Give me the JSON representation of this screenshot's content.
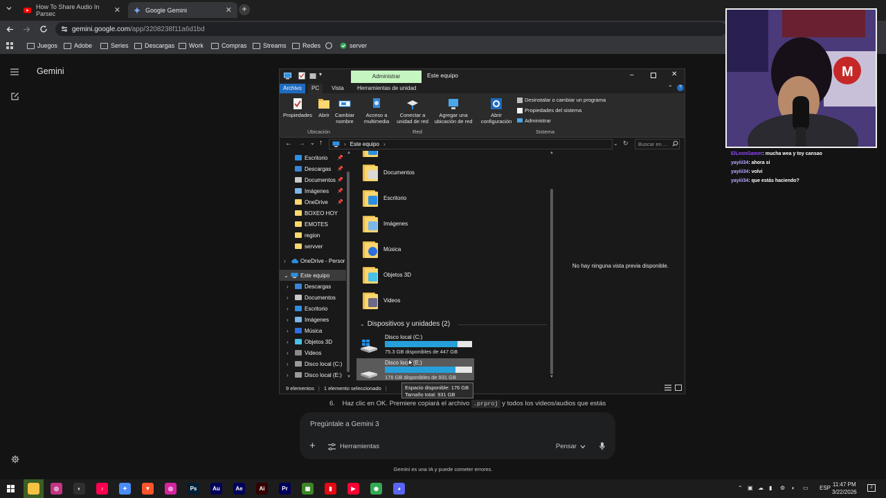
{
  "browser": {
    "tabs": [
      {
        "label": "How To Share Audio In Parsec",
        "icon": "youtube-icon",
        "active": false
      },
      {
        "label": "Google Gemini",
        "icon": "gemini-icon",
        "active": true
      }
    ],
    "url_host": "gemini.google.com",
    "url_path": "/app/3208238f11a6d1bd",
    "bookmarks": [
      "Juegos",
      "Adobe",
      "Series",
      "Descargas",
      "Work",
      "Compras",
      "Streams",
      "Redes",
      "server"
    ]
  },
  "gemini": {
    "title": "Gemini",
    "step_prefix": "6.",
    "step_text_1": "Haz clic en OK. Premiere copiará el archivo",
    "step_code": ".prproj",
    "step_text_2": "y todos los videos/audios que estás",
    "prompt_placeholder": "Pregúntale a Gemini 3",
    "tools_label": "Herramientas",
    "think_label": "Pensar",
    "disclaimer": "Gemini es una IA y puede cometer errores."
  },
  "explorer": {
    "context_tab": "Administrar",
    "window_title": "Este equipo",
    "tabs": [
      "Archivo",
      "PC",
      "Vista",
      "Herramientas de unidad"
    ],
    "ribbon": {
      "buttons": [
        {
          "label_1": "Propiedades",
          "label_2": "",
          "icon": "properties-icon"
        },
        {
          "label_1": "Abrir",
          "label_2": "",
          "icon": "open-icon"
        },
        {
          "label_1": "Cambiar",
          "label_2": "nombre",
          "icon": "rename-icon"
        },
        {
          "label_1": "Acceso a",
          "label_2": "multimedia",
          "icon": "media-access-icon"
        },
        {
          "label_1": "Conectar a",
          "label_2": "unidad de red",
          "icon": "network-drive-icon"
        },
        {
          "label_1": "Agregar una",
          "label_2": "ubicación de red",
          "icon": "network-location-icon"
        },
        {
          "label_1": "Abrir",
          "label_2": "configuración",
          "icon": "settings-icon"
        }
      ],
      "small": [
        "Desinstalar o cambiar un programa",
        "Propiedades del sistema",
        "Administrar"
      ],
      "groups": [
        "Ubicación",
        "Red",
        "Sistema"
      ]
    },
    "breadcrumb": "Este equipo",
    "search_placeholder": "Buscar en ...",
    "quick_access": [
      {
        "label": "Escritorio",
        "pinned": true,
        "color": "#2d8fe0"
      },
      {
        "label": "Descargas",
        "pinned": true,
        "color": "#3a86d6"
      },
      {
        "label": "Documentos",
        "pinned": true,
        "color": "#c9c9c9"
      },
      {
        "label": "Imágenes",
        "pinned": true,
        "color": "#7db6e8"
      },
      {
        "label": "OneDrive",
        "pinned": true,
        "color": "#f9d66e"
      },
      {
        "label": "BOXEO HOY",
        "pinned": false,
        "color": "#f9d66e"
      },
      {
        "label": "EMOTES",
        "pinned": false,
        "color": "#f9d66e"
      },
      {
        "label": "region",
        "pinned": false,
        "color": "#f9d66e"
      },
      {
        "label": "servver",
        "pinned": false,
        "color": "#f9d66e"
      }
    ],
    "onedrive_label": "OneDrive - Persor",
    "this_pc_label": "Este equipo",
    "this_pc_items": [
      {
        "label": "Descargas",
        "color": "#3a86d6"
      },
      {
        "label": "Documentos",
        "color": "#c9c9c9"
      },
      {
        "label": "Escritorio",
        "color": "#2d8fe0"
      },
      {
        "label": "Imágenes",
        "color": "#7db6e8"
      },
      {
        "label": "Música",
        "color": "#2d6fe0"
      },
      {
        "label": "Objetos 3D",
        "color": "#49c0e8"
      },
      {
        "label": "Videos",
        "color": "#8a8a8a"
      },
      {
        "label": "Disco local (C:)",
        "color": "#9a9a9a"
      },
      {
        "label": "Disco local (E:)",
        "color": "#9a9a9a"
      }
    ],
    "folders": [
      {
        "label": "Documentos",
        "emblem": "#d9d9d9"
      },
      {
        "label": "Escritorio",
        "emblem": "#2d8fe0"
      },
      {
        "label": "Imágenes",
        "emblem": "#7db6e8"
      },
      {
        "label": "Música",
        "emblem": "#2d6fe0"
      },
      {
        "label": "Objetos 3D",
        "emblem": "#49c0e8"
      },
      {
        "label": "Videos",
        "emblem": "#6a6a8a"
      }
    ],
    "devices_header": "Dispositivos y unidades (2)",
    "drives": [
      {
        "name": "Disco local (C:)",
        "free": "75.3 GB disponibles de 447 GB",
        "used_fraction": 0.83,
        "selected": false
      },
      {
        "name": "Disco local (E:)",
        "free": "176 GB disponibles de 931 GB",
        "used_fraction": 0.81,
        "selected": true
      }
    ],
    "preview_text": "No hay ninguna vista previa disponible.",
    "status_count": "9 elementos",
    "status_selected": "1 elemento seleccionado",
    "tooltip_line_1": "Espacio disponible: 176 GB",
    "tooltip_line_2": "Tamaño total: 931 GB"
  },
  "chat": [
    {
      "user": "ElLeonGamer",
      "message": "mucha wea y toy cansao",
      "user_color": "#9146ff"
    },
    {
      "user": "yayiii34",
      "message": "ahora si",
      "user_color": "#b9a8ff"
    },
    {
      "user": "yayiii34",
      "message": "volvi",
      "user_color": "#b9a8ff"
    },
    {
      "user": "yayiii34",
      "message": "que estás haciendo?",
      "user_color": "#b9a8ff"
    }
  ],
  "taskbar": {
    "apps": [
      {
        "name": "file-explorer-app",
        "glyph": "",
        "color": "#f6c244",
        "active": true
      },
      {
        "name": "instagram-app",
        "glyph": "◎",
        "color": "#c13584"
      },
      {
        "name": "obs-app",
        "glyph": "◐",
        "color": "#302e31"
      },
      {
        "name": "tiktok-app",
        "glyph": "♪",
        "color": "#ff0050"
      },
      {
        "name": "copilot-app",
        "glyph": "✦",
        "color": "#4a8cf5"
      },
      {
        "name": "brave-app",
        "glyph": "▼",
        "color": "#fb542b"
      },
      {
        "name": "instagram-app-2",
        "glyph": "◎",
        "color": "#d6249f"
      },
      {
        "name": "photoshop-app",
        "glyph": "Ps",
        "color": "#001e36"
      },
      {
        "name": "audition-app",
        "glyph": "Au",
        "color": "#00005b"
      },
      {
        "name": "after-effects-app",
        "glyph": "Ae",
        "color": "#00005b"
      },
      {
        "name": "illustrator-app",
        "glyph": "Ai",
        "color": "#330000"
      },
      {
        "name": "premiere-app",
        "glyph": "Pr",
        "color": "#00005b"
      },
      {
        "name": "minecraft-app",
        "glyph": "▦",
        "color": "#3c8527"
      },
      {
        "name": "app-red",
        "glyph": "▮",
        "color": "#e50914"
      },
      {
        "name": "youtube-music-app",
        "glyph": "▶",
        "color": "#ff0033"
      },
      {
        "name": "chrome-app",
        "glyph": "◉",
        "color": "#34a853"
      },
      {
        "name": "discord-app",
        "glyph": "◕",
        "color": "#5865f2"
      }
    ],
    "language": "ESP",
    "time": "11:47 PM",
    "date": "3/22/2026",
    "notification_count": "2"
  }
}
